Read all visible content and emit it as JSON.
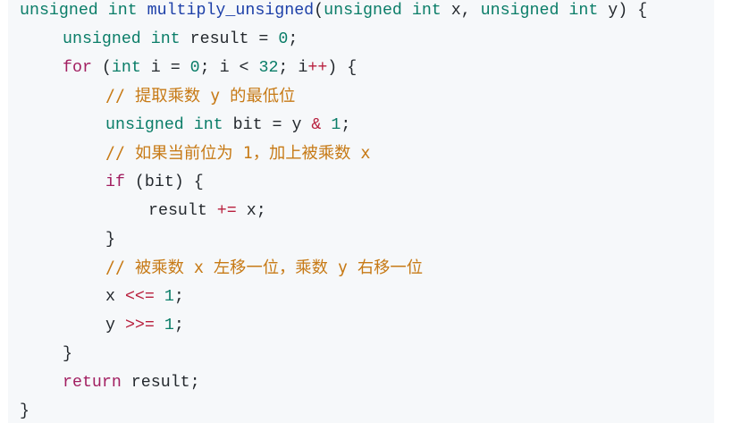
{
  "code": {
    "l1": {
      "kw1": "unsigned int",
      "fn": "multiply_unsigned",
      "p_open": "(",
      "kw2": "unsigned int",
      "a1": " x, ",
      "kw3": "unsigned int",
      "a2": " y) {"
    },
    "l2": {
      "kw": "unsigned int",
      "rest": " result = ",
      "num": "0",
      "end": ";"
    },
    "l3": {
      "ctl": "for",
      "p1": " (",
      "kw": "int",
      "p2": " i = ",
      "n1": "0",
      "p3": "; i < ",
      "n2": "32",
      "p4": "; i",
      "op": "++",
      "p5": ") {"
    },
    "l4": {
      "comment": "// 提取乘数 y 的最低位"
    },
    "l5": {
      "kw": "unsigned int",
      "p1": " bit = y ",
      "op": "&",
      "p2": " ",
      "num": "1",
      "end": ";"
    },
    "l6": {
      "comment": "// 如果当前位为 1，加上被乘数 x"
    },
    "l7": {
      "ctl": "if",
      "rest": " (bit) {"
    },
    "l8": {
      "p1": "result ",
      "op": "+=",
      "p2": " x;"
    },
    "l9": {
      "text": "}"
    },
    "l10": {
      "comment": "// 被乘数 x 左移一位，乘数 y 右移一位"
    },
    "l11": {
      "p1": "x ",
      "op": "<<=",
      "p2": " ",
      "num": "1",
      "end": ";"
    },
    "l12": {
      "p1": "y ",
      "op": ">>=",
      "p2": " ",
      "num": "1",
      "end": ";"
    },
    "l13": {
      "text": "}"
    },
    "l14": {
      "ctl": "return",
      "rest": " result;"
    },
    "l15": {
      "text": "}"
    }
  },
  "colors": {
    "background": "#f6f8fa",
    "keyword": "#0a7d68",
    "control": "#a21f61",
    "function": "#1c3fa8",
    "operator": "#b81f3d",
    "comment": "#c77a16"
  }
}
